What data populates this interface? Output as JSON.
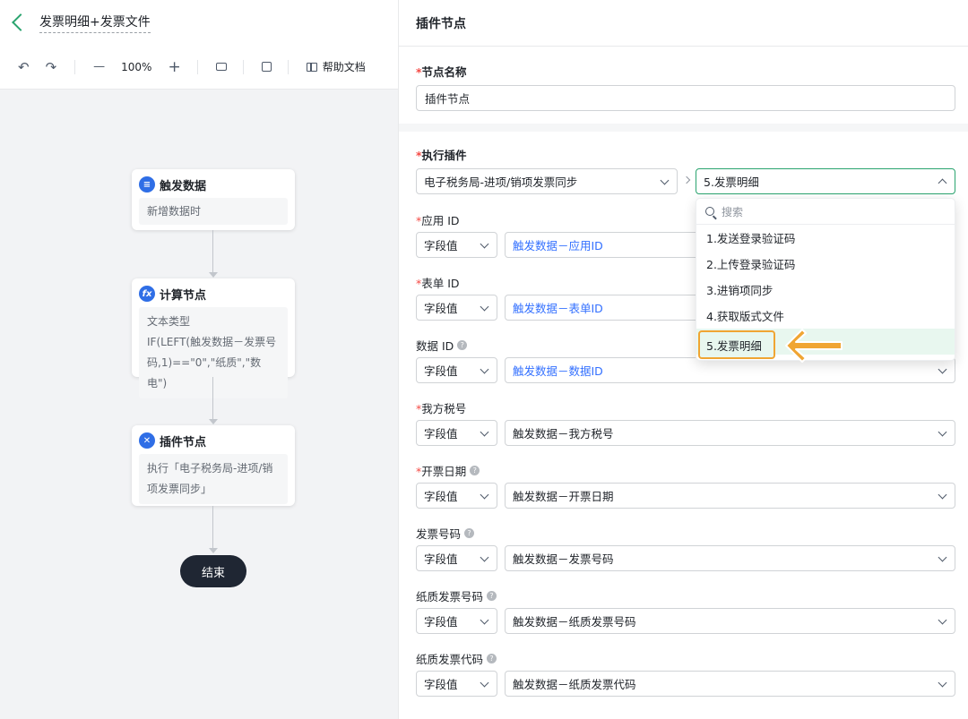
{
  "app": {
    "title": "发票明细+发票文件"
  },
  "toolbar": {
    "undo": "↶",
    "redo": "↷",
    "zoom_out": "—",
    "zoom": "100%",
    "zoom_in": "+",
    "help_docs": "帮助文档"
  },
  "flow": {
    "nodes": [
      {
        "title": "触发数据",
        "body": "新增数据时",
        "icon": "document-icon"
      },
      {
        "title": "计算节点",
        "body_lines": [
          "文本类型",
          "IF(LEFT(触发数据－发票号",
          "码,1)==\"0\",\"纸质\",\"数电\")"
        ],
        "icon": "fx-icon"
      },
      {
        "title": "插件节点",
        "body_lines": [
          "执行「电子税务局-进项/销",
          "项发票同步」"
        ],
        "icon": "plugin-icon"
      }
    ],
    "end": "结束"
  },
  "panel": {
    "title": "插件节点",
    "node_name": {
      "label": "节点名称",
      "value": "插件节点"
    },
    "plugin": {
      "label": "执行插件",
      "plugin_value": "电子税务局-进项/销项发票同步",
      "action_value": "5.发票明细"
    },
    "dropdown": {
      "search_placeholder": "搜索",
      "items": [
        "1.发送登录验证码",
        "2.上传登录验证码",
        "3.进销项同步",
        "4.获取版式文件",
        "5.发票明细"
      ]
    },
    "fields": [
      {
        "label": "应用 ID",
        "required": true,
        "help": false,
        "type": "字段值",
        "value": "触发数据－应用ID"
      },
      {
        "label": "表单 ID",
        "required": true,
        "help": false,
        "type": "字段值",
        "value": "触发数据－表单ID"
      },
      {
        "label": "数据 ID",
        "required": false,
        "help": true,
        "type": "字段值",
        "value": "触发数据－数据ID"
      },
      {
        "label": "我方税号",
        "required": true,
        "help": false,
        "type": "字段值",
        "value": "触发数据－我方税号"
      },
      {
        "label": "开票日期",
        "required": true,
        "help": true,
        "type": "字段值",
        "value": "触发数据－开票日期"
      },
      {
        "label": "发票号码",
        "required": false,
        "help": true,
        "type": "字段值",
        "value": "触发数据－发票号码"
      },
      {
        "label": "纸质发票号码",
        "required": false,
        "help": true,
        "type": "字段值",
        "value": "触发数据－纸质发票号码"
      },
      {
        "label": "纸质发票代码",
        "required": false,
        "help": true,
        "type": "字段值",
        "value": "触发数据－纸质发票代码"
      }
    ],
    "required_mark": "*",
    "help_mark": "?"
  },
  "colors": {
    "accent": "#2aa46f",
    "link": "#3370ff",
    "highlight": "#f0a533",
    "required": "#f54a45"
  }
}
